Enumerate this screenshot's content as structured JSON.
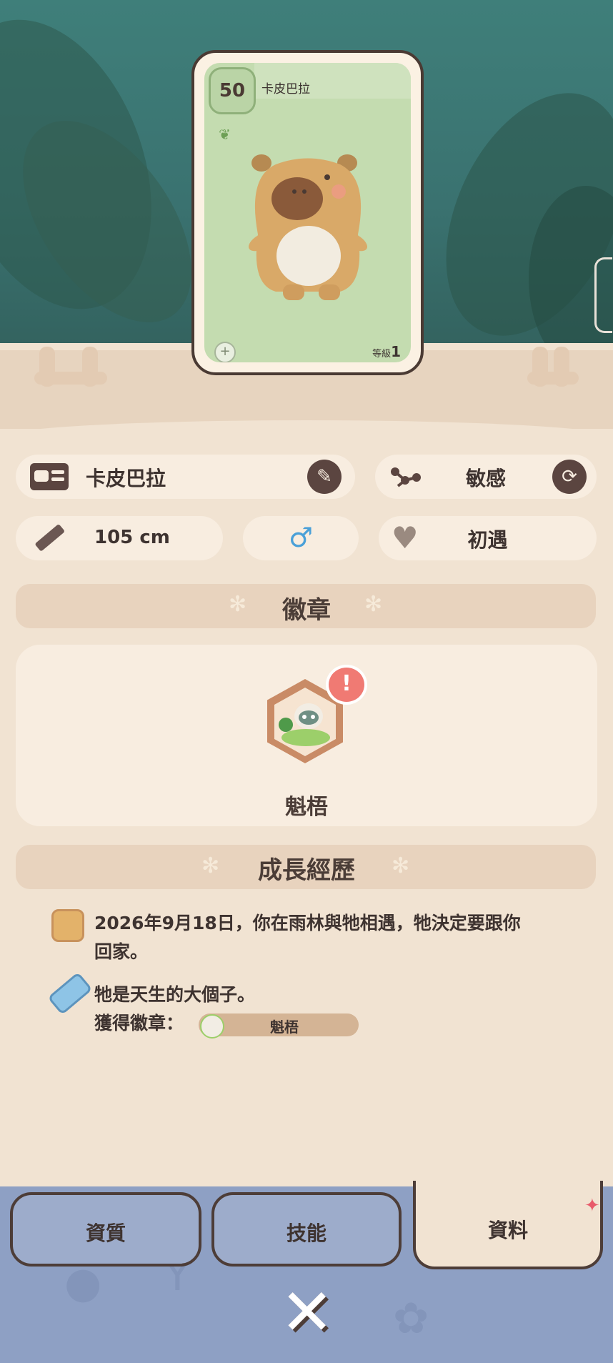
{
  "card": {
    "level": "50",
    "name": "卡皮巴拉",
    "grade_label": "等級",
    "grade_value": "1"
  },
  "info": {
    "name": "卡皮巴拉",
    "personality": "敏感",
    "height": "105 cm",
    "gender_symbol": "♂",
    "affinity": "初遇"
  },
  "sections": {
    "badges_title": "徽章",
    "growth_title": "成長經歷"
  },
  "badge": {
    "name": "魁梧",
    "alert": "!"
  },
  "history": [
    {
      "text_line1": "2026年9月18日，你在雨林與牠相遇，牠決定要跟你",
      "text_line2": "回家。"
    },
    {
      "text_line1": "牠是天生的大個子。",
      "text_line2": "獲得徽章：",
      "badge_label": "魁梧"
    }
  ],
  "tabs": [
    {
      "label": "資質"
    },
    {
      "label": "技能"
    },
    {
      "label": "資料"
    }
  ],
  "close_symbol": "✕",
  "colors": {
    "panel": "#f1e3d2",
    "pill": "#f8ede0",
    "section": "#e8d3be",
    "text": "#3e3330",
    "tabbar": "#8ea0c4"
  }
}
